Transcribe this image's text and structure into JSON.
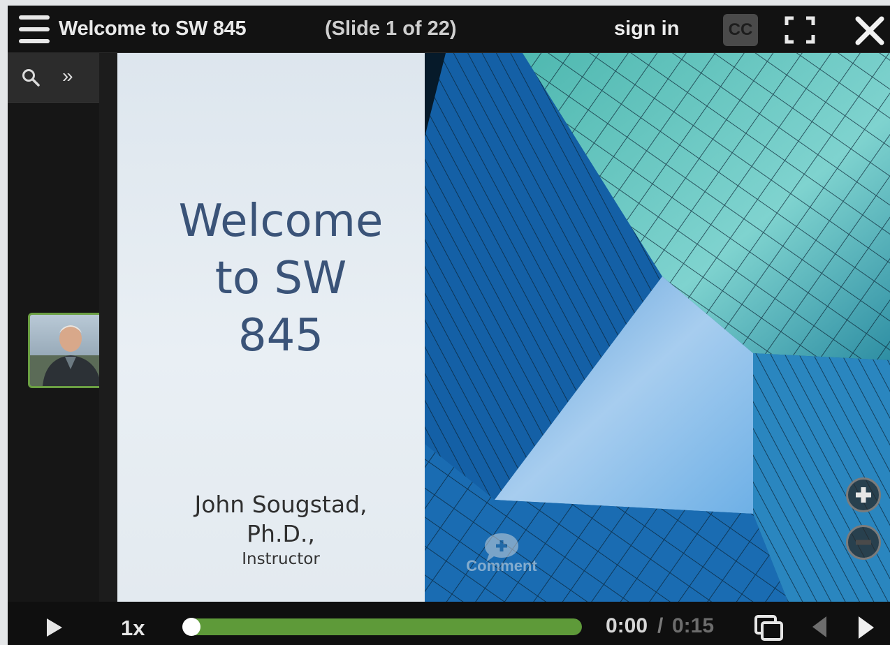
{
  "header": {
    "menu_icon": "hamburger-menu-icon",
    "title": "Welcome to SW 845",
    "slide_position": "(Slide 1 of 22)",
    "sign_in": "sign in",
    "cc_label": "CC",
    "fullscreen_icon": "fullscreen-icon",
    "close_icon": "close-icon"
  },
  "sidebar": {
    "search_icon": "search-icon",
    "expand_label": "»",
    "presenter_thumbnail": "presenter-photo"
  },
  "slide": {
    "heading_lines": [
      "Welcome",
      "to SW",
      "845"
    ],
    "author_lines": [
      "John Sougstad,",
      "Ph.D.,"
    ],
    "role": "Instructor",
    "image": "glass-building-looking-up-at-sky"
  },
  "overlay": {
    "comment_label": "Comment",
    "zoom_in_icon": "zoom-in-icon",
    "zoom_out_icon": "zoom-out-icon"
  },
  "controls": {
    "playback_speed": "1x",
    "current_time": "0:00",
    "separator": "/",
    "total_time": "0:15",
    "progress_fraction": 0.0,
    "buffered_fraction": 1.0
  },
  "colors": {
    "progress": "#5e9a39",
    "thumbnail_border": "#6b9f43",
    "slide_title": "#3a5378"
  }
}
